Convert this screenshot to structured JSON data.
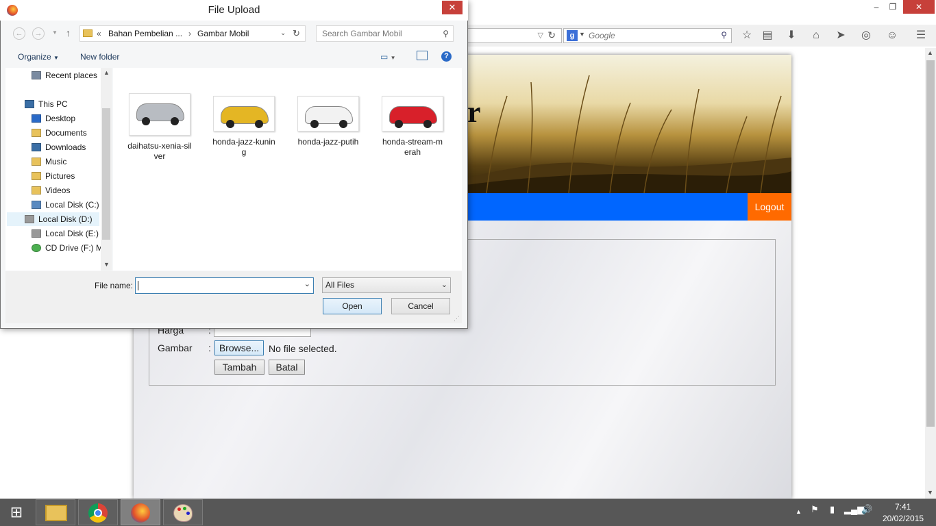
{
  "browser": {
    "window_controls": {
      "minimize": "‒",
      "restore": "❐",
      "close": "✕"
    },
    "search_placeholder": "Google",
    "search_engine_icon": "g-icon"
  },
  "page": {
    "header_text_fragment": "r",
    "logout_label": "Logout",
    "form": {
      "harga_label": "Harga",
      "gambar_label": "Gambar",
      "colon": ":",
      "browse_label": "Browse...",
      "no_file_text": "No file selected.",
      "tambah_label": "Tambah",
      "batal_label": "Batal"
    }
  },
  "dialog": {
    "title": "File Upload",
    "close": "✕",
    "address": {
      "prefix": "«",
      "segment1": "Bahan Pembelian ...",
      "separator": "›",
      "segment2": "Gambar Mobil"
    },
    "search_placeholder": "Search Gambar Mobil",
    "organize_label": "Organize",
    "new_folder_label": "New folder",
    "nav": [
      {
        "label": "Recent places"
      },
      {
        "label": "This PC"
      },
      {
        "label": "Desktop"
      },
      {
        "label": "Documents"
      },
      {
        "label": "Downloads"
      },
      {
        "label": "Music"
      },
      {
        "label": "Pictures"
      },
      {
        "label": "Videos"
      },
      {
        "label": "Local Disk (C:)"
      },
      {
        "label": "Local Disk (D:)"
      },
      {
        "label": "Local Disk (E:)"
      },
      {
        "label": "CD Drive (F:) Mol"
      }
    ],
    "files": [
      {
        "name": "daihatsu-xenia-silver",
        "color": "#b8bcc2"
      },
      {
        "name": "honda-jazz-kuning",
        "color": "#e4b624"
      },
      {
        "name": "honda-jazz-putih",
        "color": "#f2f2f2"
      },
      {
        "name": "honda-stream-merah",
        "color": "#d8202a"
      }
    ],
    "file_name_label": "File name:",
    "file_name_value": "",
    "file_type": "All Files",
    "open_label": "Open",
    "cancel_label": "Cancel"
  },
  "taskbar": {
    "time": "7:41",
    "date": "20/02/2015"
  }
}
